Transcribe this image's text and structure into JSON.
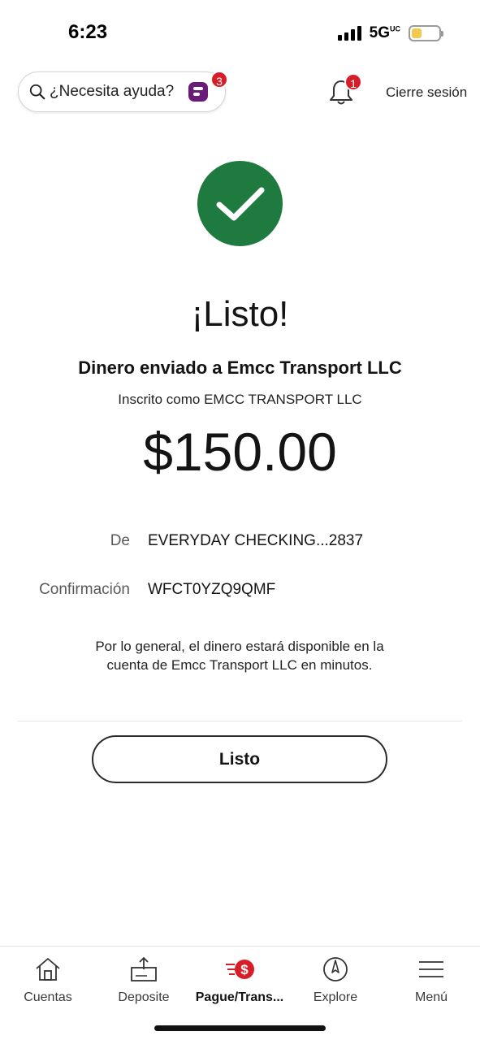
{
  "status_bar": {
    "time": "6:23",
    "network": "5G",
    "network_superscript": "UC"
  },
  "header": {
    "help_placeholder": "¿Necesita ayuda?",
    "assistant_badge": "3",
    "notifications_badge": "1",
    "logout_label": "Cierre sesión"
  },
  "confirmation": {
    "title": "¡Listo!",
    "sent_to": "Dinero enviado a Emcc Transport LLC",
    "enrolled_as": "Inscrito como EMCC TRANSPORT LLC",
    "amount": "$150.00",
    "from_label": "De",
    "from_value": "EVERYDAY CHECKING...2837",
    "confirmation_label": "Confirmación",
    "confirmation_value": "WFCT0YZQ9QMF",
    "note": "Por lo general, el dinero estará disponible en la cuenta de Emcc Transport LLC en minutos.",
    "done_button": "Listo"
  },
  "bottom_nav": {
    "items": [
      {
        "label": "Cuentas",
        "icon": "home-icon"
      },
      {
        "label": "Deposite",
        "icon": "deposit-icon"
      },
      {
        "label": "Pague/Trans...",
        "icon": "pay-transfer-icon",
        "active": true
      },
      {
        "label": "Explore",
        "icon": "compass-icon"
      },
      {
        "label": "Menú",
        "icon": "menu-icon"
      }
    ]
  },
  "colors": {
    "success_green": "#1f7a3f",
    "badge_red": "#d71e28",
    "fargo_purple": "#6a1b7a"
  }
}
